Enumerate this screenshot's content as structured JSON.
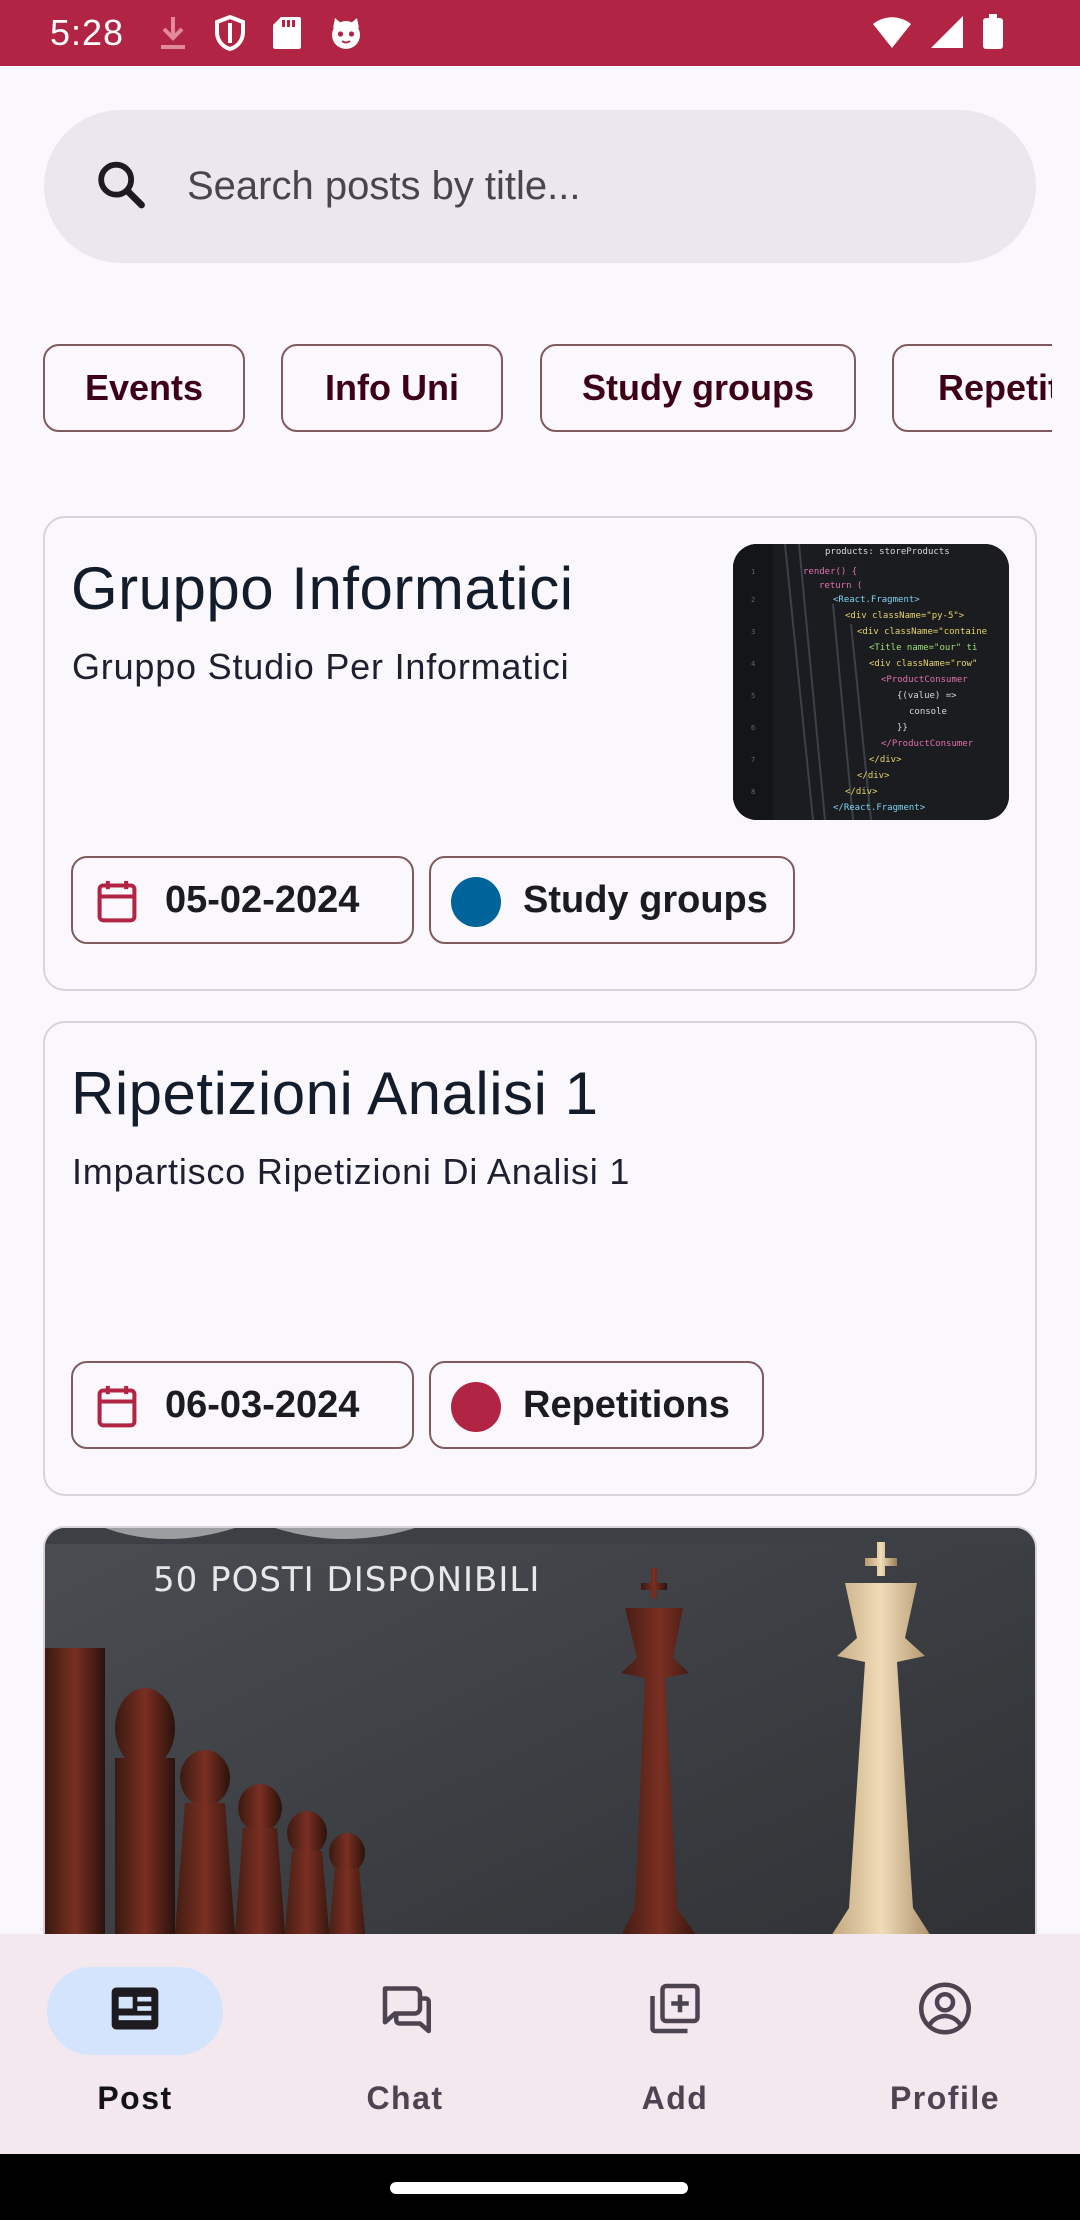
{
  "status_bar": {
    "time": "5:28",
    "left_icons": [
      "download-icon",
      "shield-icon",
      "sd-card-icon",
      "cat-face-icon"
    ],
    "right_icons": [
      "wifi-icon",
      "signal-icon",
      "battery-icon"
    ]
  },
  "search": {
    "placeholder": "Search posts by title..."
  },
  "filters": {
    "chips": [
      "Events",
      "Info Uni",
      "Study groups",
      "Repetitions"
    ]
  },
  "posts": [
    {
      "title": "Gruppo Informatici",
      "subtitle": "Gruppo Studio Per Informatici",
      "date": "05-02-2024",
      "category": "Study groups",
      "category_color": "#00639A",
      "has_thumbnail": true
    },
    {
      "title": "Ripetizioni Analisi 1",
      "subtitle": "Impartisco Ripetizioni Di Analisi 1",
      "date": "06-03-2024",
      "category": "Repetitions",
      "category_color": "#B12443",
      "has_thumbnail": false
    },
    {
      "poster_text": "50 POSTI DISPONIBILI"
    }
  ],
  "bottom_nav": {
    "items": [
      {
        "label": "Post",
        "icon": "article-icon",
        "active": true
      },
      {
        "label": "Chat",
        "icon": "chat-icon",
        "active": false
      },
      {
        "label": "Add",
        "icon": "library-add-icon",
        "active": false
      },
      {
        "label": "Profile",
        "icon": "account-circle-icon",
        "active": false
      }
    ]
  },
  "colors": {
    "status_bar": "#B12443",
    "chip_border": "#7F5A5E",
    "nav_background": "#F3E8EE",
    "nav_active_indicator": "#D3E4FC"
  }
}
